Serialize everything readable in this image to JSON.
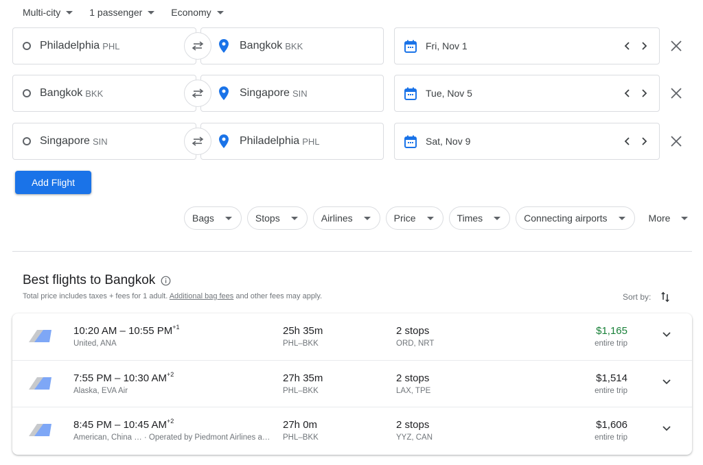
{
  "top_bar": {
    "trip_type": "Multi-city",
    "passengers": "1 passenger",
    "cabin_class": "Economy"
  },
  "legs": [
    {
      "origin_name": "Philadelphia",
      "origin_code": "PHL",
      "destination_name": "Bangkok",
      "destination_code": "BKK",
      "date": "Fri, Nov 1"
    },
    {
      "origin_name": "Bangkok",
      "origin_code": "BKK",
      "destination_name": "Singapore",
      "destination_code": "SIN",
      "date": "Tue, Nov 5"
    },
    {
      "origin_name": "Singapore",
      "origin_code": "SIN",
      "destination_name": "Philadelphia",
      "destination_code": "PHL",
      "date": "Sat, Nov 9"
    }
  ],
  "add_flight_label": "Add Flight",
  "filters": [
    "Bags",
    "Stops",
    "Airlines",
    "Price",
    "Times",
    "Connecting airports",
    "More"
  ],
  "results": {
    "title": "Best flights to Bangkok",
    "subtitle_prefix": "Total price includes taxes + fees for 1 adult.",
    "subtitle_link": "Additional bag fees",
    "subtitle_suffix": "and other fees may apply.",
    "sort_label": "Sort by:",
    "flights": [
      {
        "depart": "10:20 AM",
        "arrive": "10:55 PM",
        "day_offset": "+1",
        "airlines": "United, ANA",
        "duration": "25h 35m",
        "route": "PHL–BKK",
        "stops": "2 stops",
        "stop_airports": "ORD, NRT",
        "price": "$1,165",
        "price_note": "entire trip",
        "is_best_price": true
      },
      {
        "depart": "7:55 PM",
        "arrive": "10:30 AM",
        "day_offset": "+2",
        "airlines": "Alaska, EVA Air",
        "duration": "27h 35m",
        "route": "PHL–BKK",
        "stops": "2 stops",
        "stop_airports": "LAX, TPE",
        "price": "$1,514",
        "price_note": "entire trip",
        "is_best_price": false
      },
      {
        "depart": "8:45 PM",
        "arrive": "10:45 AM",
        "day_offset": "+2",
        "airlines": "American, China … · Operated by Piedmont Airlines a…",
        "duration": "27h 0m",
        "route": "PHL–BKK",
        "stops": "2 stops",
        "stop_airports": "YYZ, CAN",
        "price": "$1,606",
        "price_note": "entire trip",
        "is_best_price": false
      }
    ]
  },
  "colors": {
    "accent": "#1a73e8",
    "best_price": "#188038",
    "text_primary": "#202124",
    "text_secondary": "#70757a",
    "border": "#dadce0"
  },
  "icons": {
    "origin": "origin-ring-icon",
    "destination": "location-pin-icon",
    "swap": "swap-arrows-icon",
    "date": "calendar-icon",
    "prev": "chevron-left-icon",
    "next": "chevron-right-icon",
    "remove": "close-icon",
    "info": "info-icon",
    "sort": "sort-icon",
    "expand": "chevron-down-icon",
    "airline": "airline-tail-icon"
  }
}
